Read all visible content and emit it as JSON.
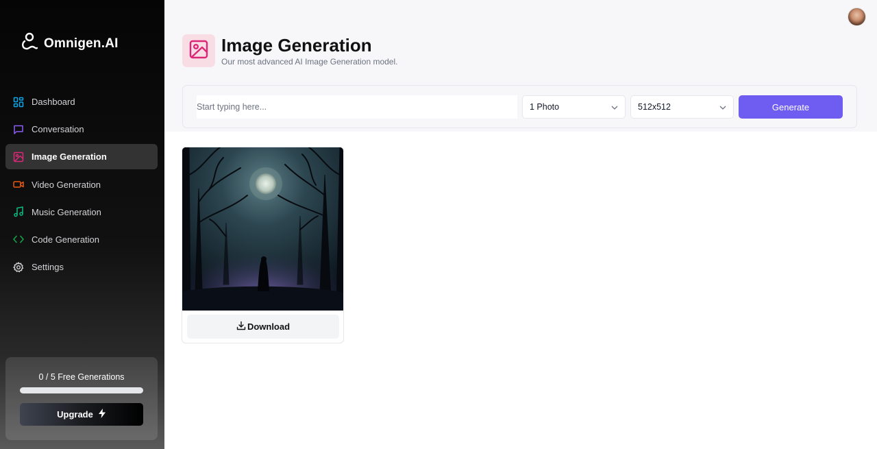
{
  "app": {
    "name": "Omnigen.AI"
  },
  "sidebar": {
    "items": [
      {
        "label": "Dashboard",
        "icon": "dashboard-icon",
        "color": "#0ea5e9",
        "active": false
      },
      {
        "label": "Conversation",
        "icon": "chat-icon",
        "color": "#8b5cf6",
        "active": false
      },
      {
        "label": "Image Generation",
        "icon": "image-icon",
        "color": "#db2777",
        "active": true
      },
      {
        "label": "Video Generation",
        "icon": "video-icon",
        "color": "#ea580c",
        "active": false
      },
      {
        "label": "Music Generation",
        "icon": "music-icon",
        "color": "#10b981",
        "active": false
      },
      {
        "label": "Code Generation",
        "icon": "code-icon",
        "color": "#16a34a",
        "active": false
      },
      {
        "label": "Settings",
        "icon": "gear-icon",
        "color": "#d4d4d8",
        "active": false
      }
    ],
    "usage": {
      "text": "0 / 5 Free Generations",
      "used": 0,
      "limit": 5
    },
    "upgrade_label": "Upgrade"
  },
  "header": {
    "title": "Image Generation",
    "subtitle": "Our most advanced AI Image Generation model."
  },
  "form": {
    "prompt_placeholder": "Start typing here...",
    "prompt_value": "",
    "amount_selected": "1 Photo",
    "resolution_selected": "512x512",
    "generate_label": "Generate"
  },
  "results": [
    {
      "download_label": "Download"
    }
  ],
  "colors": {
    "accent": "#6f5cf0",
    "image_accent": "#db2777",
    "sidebar_bg": "#0a0a0a"
  }
}
